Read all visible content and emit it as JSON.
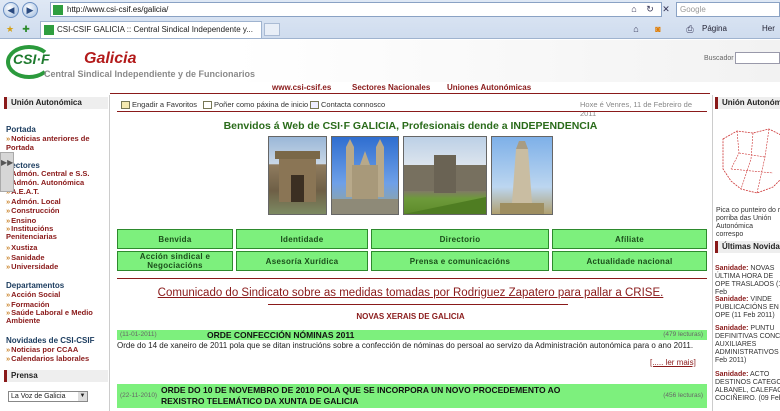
{
  "browser": {
    "url": "http://www.csi-csif.es/galicia/",
    "search_placeholder": "Google",
    "tab_title": "CSI-CSIF GALICIA :: Central Sindical Independente y...",
    "pagina_label": "Página",
    "herr_label": "Her"
  },
  "header": {
    "logo_text": "CSI·F",
    "brand": "Galicia",
    "subtitle": "Central Sindical Independiente y de Funcionarios",
    "search_label": "Buscador"
  },
  "topnav": {
    "links": [
      "www.csi-csif.es",
      "Sectores Nacionales",
      "Uniones Autonómicas"
    ]
  },
  "left": {
    "title": "Unión Autonómica",
    "portada_title": "Portada",
    "portada_link": "Noticias anteriores de Portada",
    "sectores_title": "Sectores",
    "sector_links": [
      "Admón. Central e S.S.",
      "Admón. Autonómica",
      "A.E.A.T.",
      "Admón. Local",
      "Construcción",
      "Ensino",
      "Institucións Penitenciarias",
      "Xustiza",
      "Sanidade",
      "Universidade"
    ],
    "departamentos_title": "Departamentos",
    "dept_links": [
      "Acción Social",
      "Formación",
      "Saúde Laboral e Medio Ambiente"
    ],
    "novidades_title": "Novidades de CSI-CSIF",
    "novidades_links": [
      "Noticias por CCAA",
      "Calendarios laborales"
    ],
    "prensa_title": "Prensa",
    "prensa_selected": "La Voz de Galicia"
  },
  "main": {
    "util_favoritos": "Engadir a Favoritos",
    "util_inicio": "Poñer como páxina de inicio",
    "util_contacto": "Contacta connosco",
    "date": "Hoxe é Venres, 11 de Febreiro de 2011",
    "welcome": "Benvidos á Web de CSI·F GALICIA, Profesionais dende a INDEPENDENCIA",
    "menu": [
      "Benvida",
      "Identidade",
      "Directorio",
      "Afíliate",
      "Acción sindical e Negociacións",
      "Asesoría Xurídica",
      "Prensa e comunicacións",
      "Actualidade nacional"
    ],
    "comunicado": "Comunicado do Sindicato sobre as medidas tomadas por Rodriguez Zapatero para pallar a CRISE.",
    "novas_title": "NOVAS XERAIS DE GALICIA",
    "news": [
      {
        "date": "(11-01-2011)",
        "title": "ORDE CONFECCIÓN NÓMINAS 2011",
        "reads": "(479 lecturas)",
        "text": "Orde do 14 de xaneiro de 2011 pola que se ditan instrucións sobre a confección de nóminas do persoal ao servizo da Administración autonómica para o ano 2011.",
        "more": "[..... ler mais]"
      },
      {
        "date": "(22-11-2010)",
        "title": "ORDE DO 10 DE NOVEMBRO DE 2010 POLA QUE SE INCORPORA UN NOVO PROCEDEMENTO AO REXISTRO TELEMÁTICO DA XUNTA DE GALICIA",
        "reads": "(456 lecturas)"
      }
    ]
  },
  "right": {
    "title": "Unión Autonómi",
    "map_caption": "Pica co punteiro do r porriba das Unión Autonómica correspo",
    "novedades_title": "Últimas Novidad",
    "items": [
      {
        "label": "Sanidade:",
        "text": "NOVAS ÚLTIMA HORA DE OPE TRASLADOS (11 Feb"
      },
      {
        "label": "Sanidade:",
        "text": "VINDE PUBLICACIÓNS EN OPE (11 Feb 2011)"
      },
      {
        "label": "Sanidade:",
        "text": "PUNTU DEFINITIVAS CONCU AUXILIARES ADMINISTRATIVOS E Feb 2011)"
      },
      {
        "label": "Sanidade:",
        "text": "ACTO DESTINOS CATEGOR ALBANEL, CALEFACT COCIÑEIRO. (09 Feb"
      }
    ]
  },
  "colors": {
    "accent": "#8a1a1a",
    "green": "#7df07d",
    "brand_red": "#b31b1b"
  }
}
